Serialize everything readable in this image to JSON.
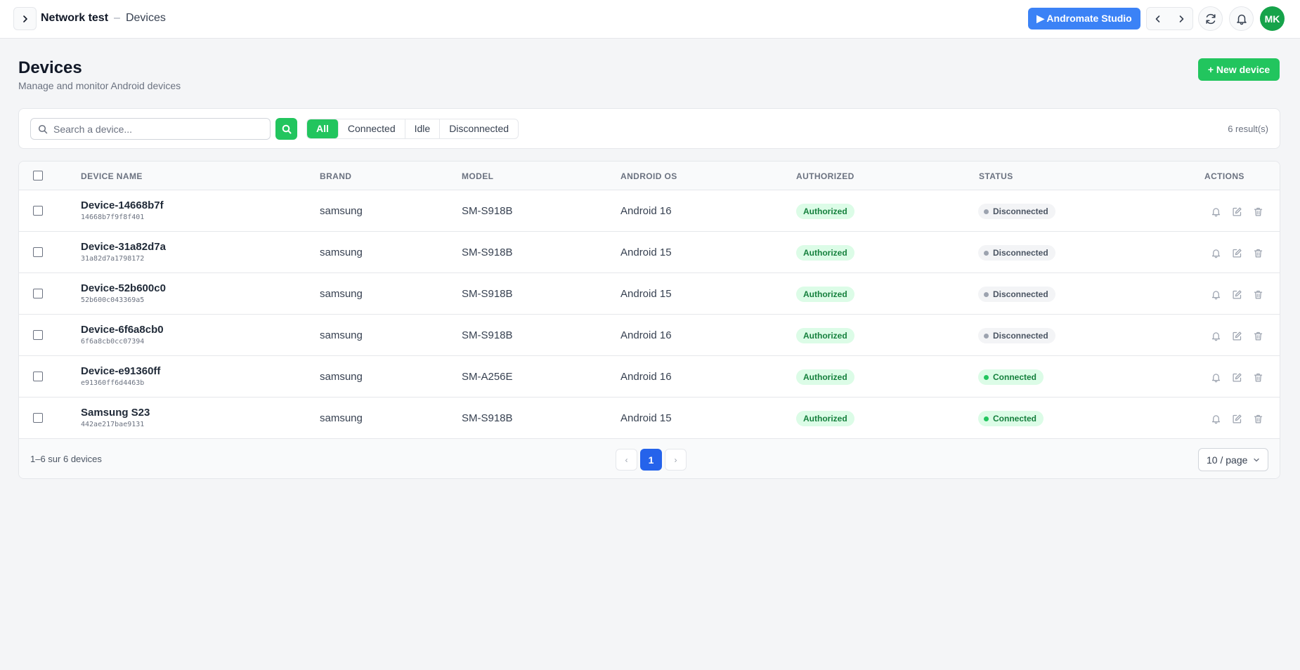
{
  "topbar": {
    "project": "Network test",
    "separator": "–",
    "page": "Devices",
    "studio_label": "▶ Andromate Studio",
    "avatar_initials": "MK",
    "accent": "#3b82f6"
  },
  "header": {
    "title": "Devices",
    "subtitle": "Manage and monitor Android devices",
    "new_button": "+ New device"
  },
  "filters": {
    "search_placeholder": "Search a device...",
    "search_value": "",
    "options": [
      "All",
      "Connected",
      "Idle",
      "Disconnected"
    ],
    "active": "All",
    "result_count": "6 result(s)"
  },
  "table": {
    "columns": [
      "DEVICE NAME",
      "BRAND",
      "MODEL",
      "ANDROID OS",
      "AUTHORIZED",
      "STATUS",
      "ACTIONS"
    ],
    "rows": [
      {
        "name": "Device-14668b7f",
        "id": "14668b7f9f8f401",
        "brand": "samsung",
        "model": "SM-S918B",
        "os": "Android 16",
        "authorized": "Authorized",
        "status": "Disconnected"
      },
      {
        "name": "Device-31a82d7a",
        "id": "31a82d7a1798172",
        "brand": "samsung",
        "model": "SM-S918B",
        "os": "Android 15",
        "authorized": "Authorized",
        "status": "Disconnected"
      },
      {
        "name": "Device-52b600c0",
        "id": "52b600c043369a5",
        "brand": "samsung",
        "model": "SM-S918B",
        "os": "Android 15",
        "authorized": "Authorized",
        "status": "Disconnected"
      },
      {
        "name": "Device-6f6a8cb0",
        "id": "6f6a8cb0cc07394",
        "brand": "samsung",
        "model": "SM-S918B",
        "os": "Android 16",
        "authorized": "Authorized",
        "status": "Disconnected"
      },
      {
        "name": "Device-e91360ff",
        "id": "e91360ff6d4463b",
        "brand": "samsung",
        "model": "SM-A256E",
        "os": "Android 16",
        "authorized": "Authorized",
        "status": "Connected"
      },
      {
        "name": "Samsung S23",
        "id": "442ae217bae9131",
        "brand": "samsung",
        "model": "SM-S918B",
        "os": "Android 15",
        "authorized": "Authorized",
        "status": "Connected"
      }
    ]
  },
  "footer": {
    "range_text": "1–6 sur 6 devices",
    "current_page": "1",
    "prev": "‹",
    "next": "›",
    "per_page": "10 / page"
  },
  "colors": {
    "green": "#22c55e",
    "blue": "#2563eb",
    "connected": "#22c55e",
    "disconnected": "#9ca3af"
  }
}
